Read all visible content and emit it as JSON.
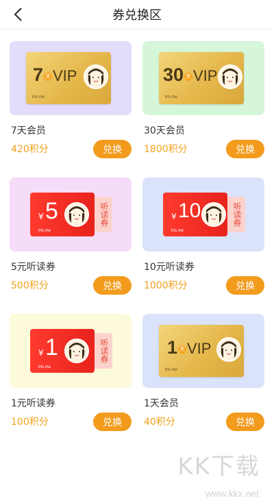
{
  "header": {
    "title": "券兑换区",
    "back_icon": "chevron-left-icon"
  },
  "redeem_label": "兑换",
  "cards": [
    {
      "kind": "vip",
      "bg": "#e4dcfb",
      "value": "7",
      "tian": "天",
      "vip": "VIP",
      "url": "lrts.me",
      "name": "7天会员",
      "points": "420积分"
    },
    {
      "kind": "vip",
      "bg": "#d5f6d9",
      "value": "30",
      "tian": "天",
      "vip": "VIP",
      "url": "lrts.me",
      "name": "30天会员",
      "points": "1800积分"
    },
    {
      "kind": "coupon",
      "bg": "#f5dcf8",
      "value": "5",
      "yen": "¥",
      "stub": "听读券",
      "url": "lrts.me",
      "name": "5元听读券",
      "points": "500积分"
    },
    {
      "kind": "coupon",
      "bg": "#dbe3fb",
      "value": "10",
      "yen": "¥",
      "stub": "听读券",
      "url": "lrts.me",
      "name": "10元听读券",
      "points": "1000积分"
    },
    {
      "kind": "coupon",
      "bg": "#fdfadb",
      "value": "1",
      "yen": "¥",
      "stub": "听读券",
      "url": "lrts.me",
      "name": "1元听读券",
      "points": "100积分"
    },
    {
      "kind": "vip",
      "bg": "#dbe3fb",
      "value": "1",
      "tian": "天",
      "vip": "VIP",
      "url": "lrts.me",
      "name": "1天会员",
      "points": "40积分"
    }
  ],
  "watermark": {
    "text": "KK下载",
    "sub": "www.kkx.net"
  }
}
